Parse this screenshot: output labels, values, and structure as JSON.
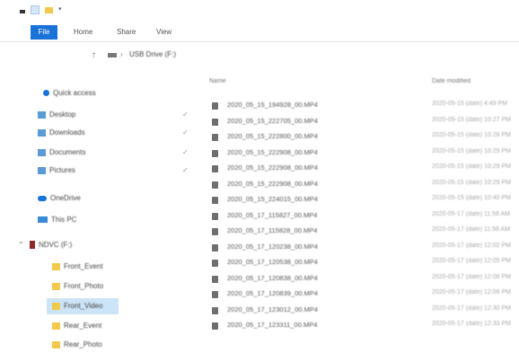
{
  "window": {
    "tabs": {
      "file": "File",
      "home": "Home",
      "share": "Share",
      "view": "View"
    },
    "address": {
      "drive": "USB Drive (F:)"
    }
  },
  "sidebar": {
    "items": [
      {
        "label": "Quick access",
        "icon": "star-icon",
        "pinned": false
      },
      {
        "label": "Desktop",
        "icon": "desktop-folder-icon",
        "pinned": true
      },
      {
        "label": "Downloads",
        "icon": "download-folder-icon",
        "pinned": true
      },
      {
        "label": "Documents",
        "icon": "documents-folder-icon",
        "pinned": true
      },
      {
        "label": "Pictures",
        "icon": "pictures-folder-icon",
        "pinned": true
      },
      {
        "label": "OneDrive",
        "icon": "cloud-icon",
        "pinned": false
      },
      {
        "label": "This PC",
        "icon": "computer-icon",
        "pinned": false
      },
      {
        "label": "NDVC (F:)",
        "icon": "usb-drive-icon",
        "pinned": false
      },
      {
        "label": "Front_Event",
        "icon": "folder-icon",
        "pinned": false
      },
      {
        "label": "Front_Photo",
        "icon": "folder-icon",
        "pinned": false
      },
      {
        "label": "Front_Video",
        "icon": "folder-icon",
        "pinned": false,
        "selected": true
      },
      {
        "label": "Rear_Event",
        "icon": "folder-icon",
        "pinned": false
      },
      {
        "label": "Rear_Photo",
        "icon": "folder-icon",
        "pinned": false
      }
    ],
    "pin_glyph": "✓"
  },
  "list": {
    "headers": {
      "name": "Name",
      "date": "Date modified"
    },
    "files": [
      {
        "name": "2020_05_15_194928_00.MP4",
        "date": "2020-05-15 (date) 4:49 PM"
      },
      {
        "name": "2020_05_15_222705_00.MP4",
        "date": "2020-05-15 (date) 10:27 PM"
      },
      {
        "name": "2020_05_15_222800_00.MP4",
        "date": "2020-05-15 (date) 10:28 PM"
      },
      {
        "name": "2020_05_15_222908_00.MP4",
        "date": "2020-05-15 (date) 10:29 PM"
      },
      {
        "name": "2020_05_15_222908_00.MP4",
        "date": "2020-05-15 (date) 10:29 PM"
      },
      {
        "name": "2020_05_15_222908_00.MP4",
        "date": "2020-05-15 (date) 10:29 PM"
      },
      {
        "name": "2020_05_15_224015_00.MP4",
        "date": "2020-05-15 (date) 10:40 PM"
      },
      {
        "name": "2020_05_17_115827_00.MP4",
        "date": "2020-05-17 (date) 11:58 AM"
      },
      {
        "name": "2020_05_17_115828_00.MP4",
        "date": "2020-05-17 (date) 11:58 AM"
      },
      {
        "name": "2020_05_17_120238_00.MP4",
        "date": "2020-05-17 (date) 12:02 PM"
      },
      {
        "name": "2020_05_17_120538_00.MP4",
        "date": "2020-05-17 (date) 12:05 PM"
      },
      {
        "name": "2020_05_17_120838_00.MP4",
        "date": "2020-05-17 (date) 12:08 PM"
      },
      {
        "name": "2020_05_17_120839_00.MP4",
        "date": "2020-05-17 (date) 12:08 PM"
      },
      {
        "name": "2020_05_17_123012_00.MP4",
        "date": "2020-05-17 (date) 12:30 PM"
      },
      {
        "name": "2020_05_17_123311_00.MP4",
        "date": "2020-05-17 (date) 12:33 PM"
      }
    ]
  },
  "colors": {
    "accent": "#1a73d9",
    "selection": "#cce4f7",
    "folder": "#f2c94c"
  }
}
